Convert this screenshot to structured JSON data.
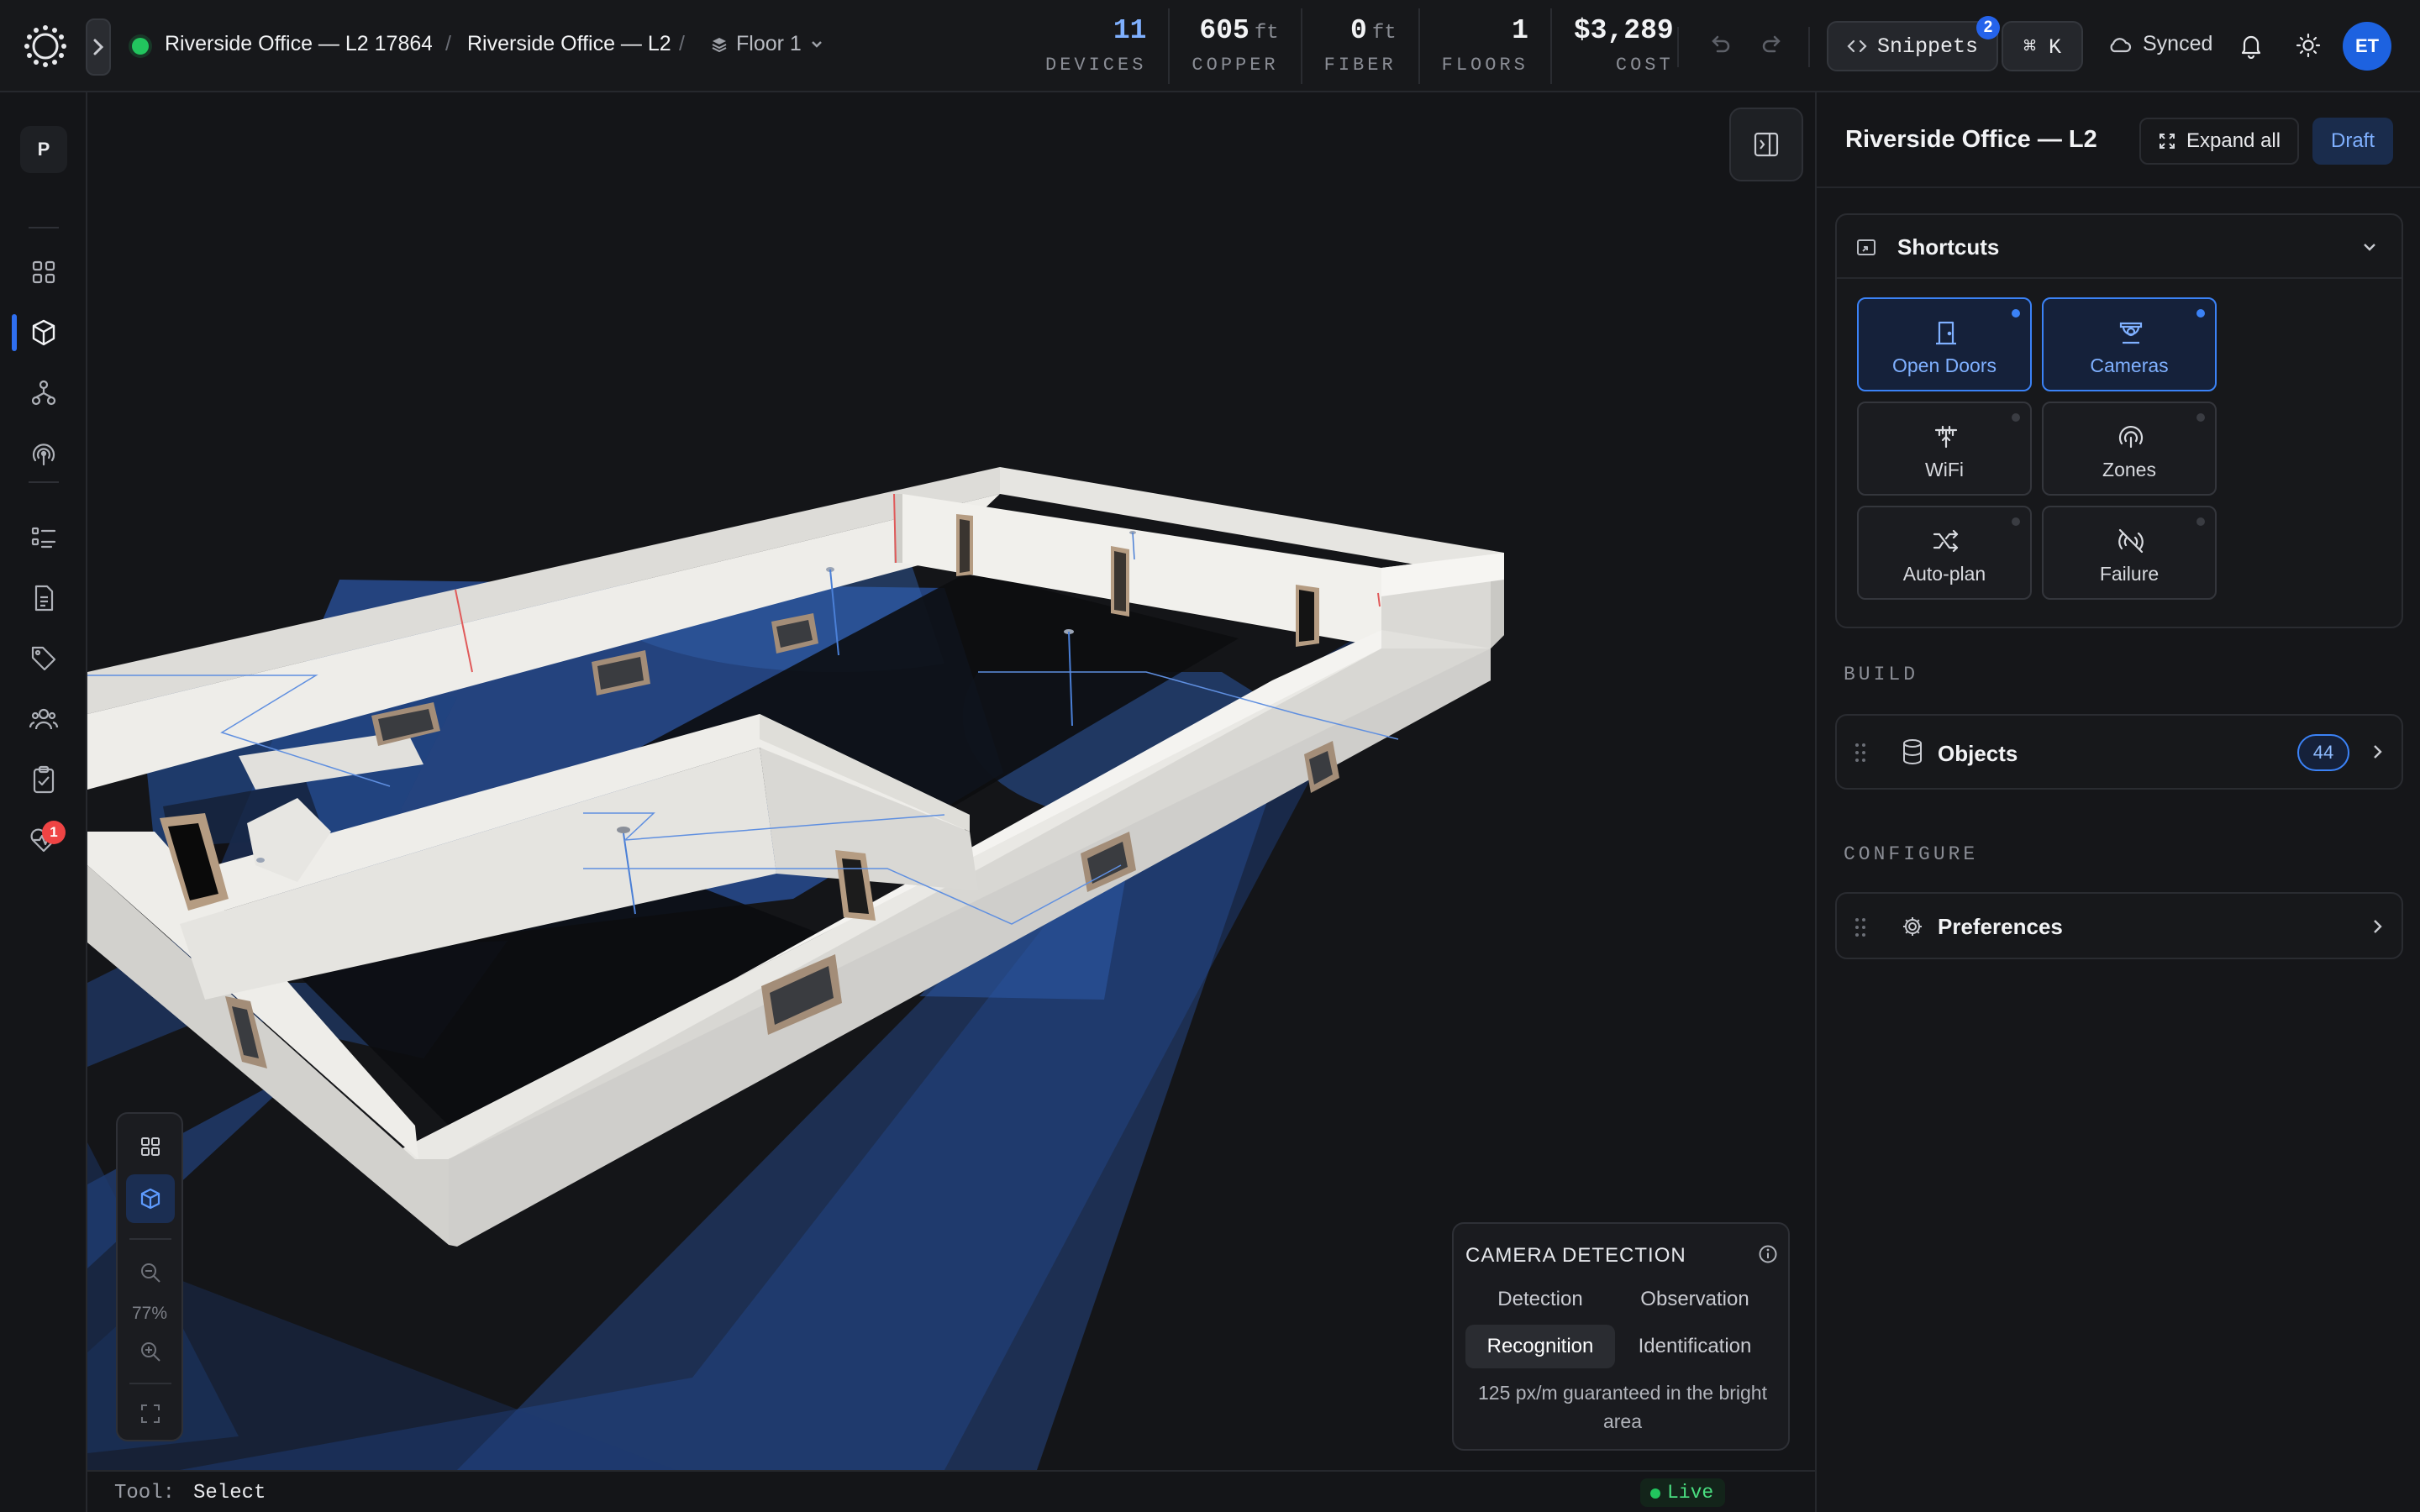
{
  "header": {
    "project_breadcrumb": "Riverside Office — L2 17864",
    "page_breadcrumb": "Riverside Office — L2",
    "floor_selector": "Floor 1",
    "stats": [
      {
        "value": "11",
        "unit": "",
        "label": "DEVICES"
      },
      {
        "value": "605",
        "unit": "ft",
        "label": "COPPER"
      },
      {
        "value": "0",
        "unit": "ft",
        "label": "FIBER"
      },
      {
        "value": "1",
        "unit": "",
        "label": "FLOORS"
      },
      {
        "value": "$3,289",
        "unit": "",
        "label": "COST"
      }
    ],
    "snippets_label": "Snippets",
    "snippets_count": "2",
    "command_label": "⌘ K",
    "sync_status": "Synced",
    "user_initials": "ET",
    "icons": [
      "undo-icon",
      "redo-icon",
      "code-icon",
      "cloud-icon",
      "bell-icon",
      "sun-icon"
    ]
  },
  "rail": {
    "project_initial": "P",
    "health_badge": "1",
    "items": [
      "dashboard-icon",
      "3d-view-icon",
      "topology-icon",
      "coverage-icon",
      "list-icon",
      "document-icon",
      "tag-icon",
      "team-icon",
      "checklist-icon",
      "health-icon"
    ]
  },
  "viewport": {
    "zoom_level": "77%",
    "camera_card": {
      "title": "CAMERA DETECTION",
      "tabs": [
        "Detection",
        "Observation",
        "Recognition",
        "Identification"
      ],
      "active_tab": "Recognition",
      "note": "125 px/m guaranteed in the bright area"
    }
  },
  "panel": {
    "title": "Riverside Office — L2",
    "expand_label": "Expand all",
    "status_label": "Draft",
    "shortcuts": {
      "title": "Shortcuts",
      "tiles": [
        {
          "label": "Open Doors",
          "icon": "door-icon",
          "active": true
        },
        {
          "label": "Cameras",
          "icon": "camera-icon",
          "active": true
        },
        {
          "label": "WiFi",
          "icon": "antenna-icon",
          "active": false
        },
        {
          "label": "Zones",
          "icon": "zones-icon",
          "active": false
        },
        {
          "label": "Auto-plan",
          "icon": "shuffle-icon",
          "active": false
        },
        {
          "label": "Failure",
          "icon": "signal-off-icon",
          "active": false
        }
      ]
    },
    "build_label": "BUILD",
    "objects_label": "Objects",
    "objects_count": "44",
    "configure_label": "CONFIGURE",
    "preferences_label": "Preferences"
  },
  "statusbar": {
    "tool_label": "Tool:",
    "tool_value": "Select",
    "live_label": "Live"
  },
  "colors": {
    "accent": "#3b82f6",
    "coverage": "#2a5fb8",
    "walls": "#ecebe8",
    "status_ok": "#22c55e",
    "alert": "#ef4444"
  }
}
